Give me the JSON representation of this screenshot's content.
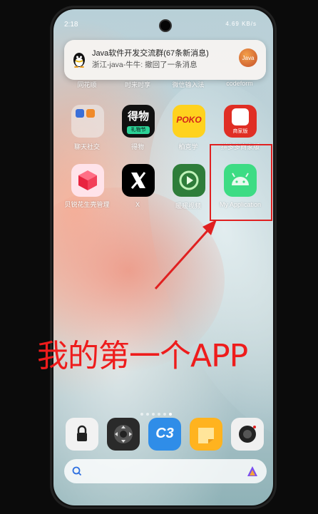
{
  "status_bar": {
    "time": "2:18",
    "right": "4.69 KB/s"
  },
  "notification": {
    "title": "Java软件开发交流群(67条新消息)",
    "message": "浙江-java-牛牛: 撤回了一条消息",
    "avatar_text": "Java"
  },
  "home": {
    "row0": [
      "同花顺",
      "时来时享",
      "微信输入法",
      "codeform"
    ],
    "row1": [
      "聊天社交",
      "得物",
      "柏克学",
      "拼多多商家版"
    ],
    "row2": [
      "贝锐花生壳管理",
      "X",
      "暖暖视频",
      "My Application"
    ],
    "icons": {
      "dewu_text": "得物",
      "dewu_sub": "礼物节",
      "poko_text": "POKO",
      "pdd_sub": "商家版"
    }
  },
  "dock": {
    "c3_text": "C3"
  },
  "annotation": {
    "text": "我的第一个APP",
    "color": "#ee1c1c"
  }
}
